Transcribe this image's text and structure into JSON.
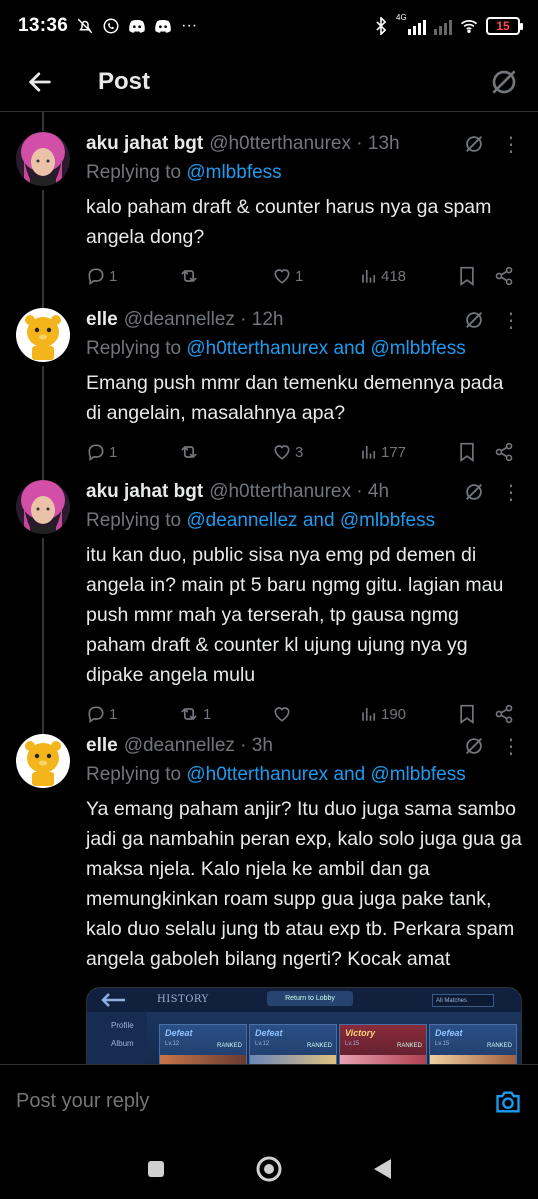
{
  "status_bar": {
    "time": "13:36",
    "notification_icons": [
      "mute-icon",
      "whatsapp-icon",
      "discord-icon",
      "discord-icon",
      "more-dots-icon"
    ],
    "network": "4G",
    "battery": "15"
  },
  "header": {
    "title": "Post"
  },
  "tweets": [
    {
      "name": "aku jahat bgt",
      "handle": "@h0tterthanurex · 13h",
      "replying_prefix": "Replying to ",
      "replying_to": "@mlbbfess",
      "replying_and": "",
      "replying_to2": "",
      "text": "kalo paham draft & counter harus nya ga spam angela dong?",
      "replies": "1",
      "reposts": "",
      "likes": "1",
      "views": "418",
      "avatar": "pink-hair"
    },
    {
      "name": "elle",
      "handle": "@deannellez · 12h",
      "replying_prefix": "Replying to ",
      "replying_to": "@h0tterthanurex",
      "replying_and": " and ",
      "replying_to2": "@mlbbfess",
      "text": "Emang push mmr dan temenku demennya pada di angelain, masalahnya apa?",
      "replies": "1",
      "reposts": "",
      "likes": "3",
      "views": "177",
      "avatar": "yellow-bear"
    },
    {
      "name": "aku jahat bgt",
      "handle": "@h0tterthanurex · 4h",
      "replying_prefix": "Replying to ",
      "replying_to": "@deannellez",
      "replying_and": " and ",
      "replying_to2": "@mlbbfess",
      "text": "itu kan duo,  public sisa nya emg pd demen di angela in? main pt 5 baru ngmg gitu. lagian mau push mmr mah ya terserah, tp gausa ngmg paham draft & counter kl ujung ujung nya yg dipake angela mulu",
      "replies": "1",
      "reposts": "1",
      "likes": "",
      "views": "190",
      "avatar": "pink-hair"
    },
    {
      "name": "elle",
      "handle": "@deannellez · 3h",
      "replying_prefix": "Replying to ",
      "replying_to": "@h0tterthanurex",
      "replying_and": " and ",
      "replying_to2": "@mlbbfess",
      "text": "Ya emang paham anjir? Itu duo juga sama sambo jadi ga nambahin peran exp, kalo solo juga gua ga maksa njela.  Kalo njela ke ambil dan ga memungkinkan roam supp gua juga pake tank, kalo duo selalu jung tb atau exp tb. Perkara spam angela gaboleh bilang ngerti? Kocak amat",
      "avatar": "yellow-bear"
    }
  ],
  "preview_image": {
    "header": "HISTORY",
    "button": "Return to Lobby",
    "dropdown": "All Matches",
    "sidebar": [
      "Profile",
      "Album"
    ],
    "cards": [
      {
        "result": "Defeat",
        "level": "Lv.12",
        "mode": "RANKED"
      },
      {
        "result": "Defeat",
        "level": "Lv.12",
        "mode": "RANKED"
      },
      {
        "result": "Victory",
        "level": "Lv.15",
        "mode": "RANKED"
      },
      {
        "result": "Defeat",
        "level": "Lv.15",
        "mode": "RANKED"
      }
    ]
  },
  "reply_bar": {
    "placeholder": "Post your reply"
  },
  "colors": {
    "link": "#1d9bf0",
    "muted": "#71767b",
    "text": "#e7e9ea",
    "background": "#000000"
  }
}
